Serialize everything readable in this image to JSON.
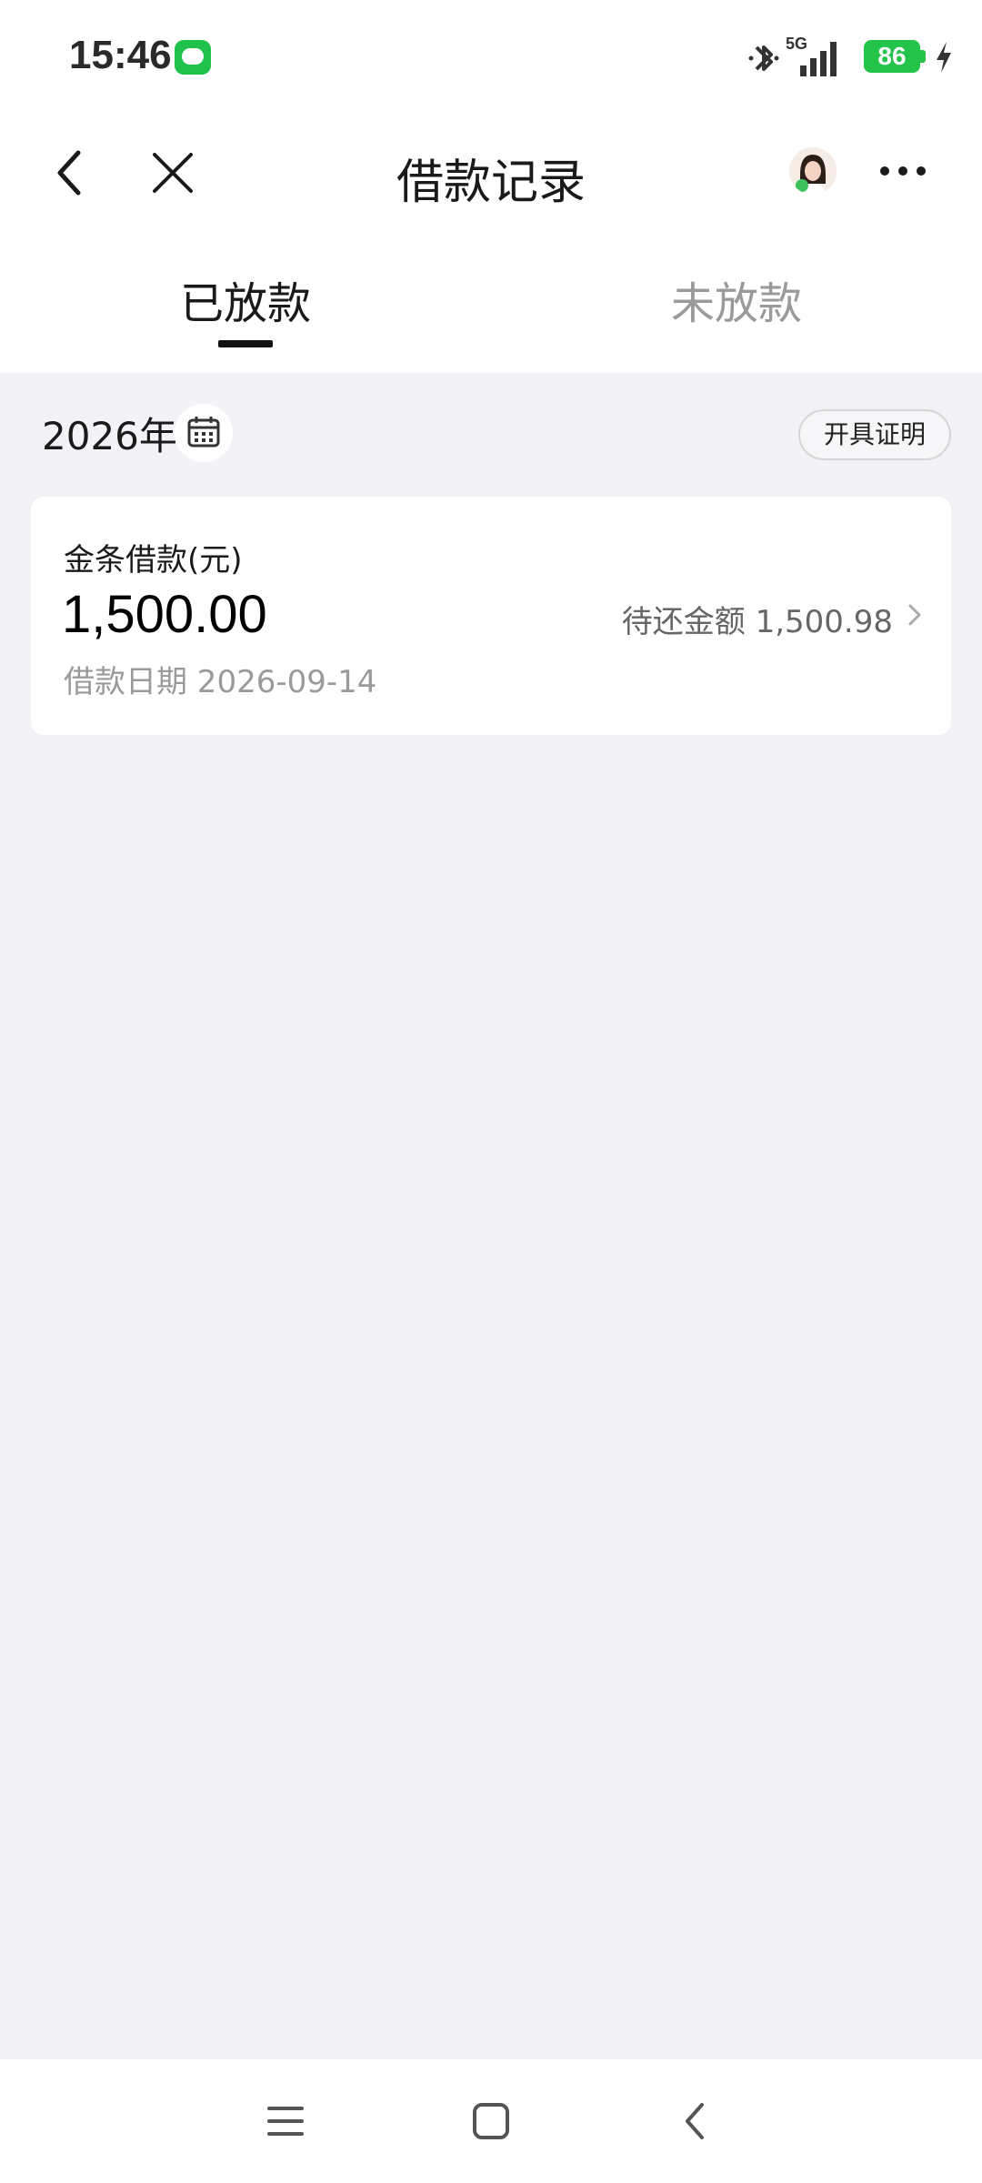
{
  "status_bar": {
    "time": "15:46",
    "network": "5G",
    "battery_level": "86",
    "icons": [
      "message-icon",
      "bluetooth-icon",
      "signal-icon",
      "battery-icon",
      "charging-icon"
    ]
  },
  "nav": {
    "title": "借款记录",
    "icons": [
      "back-icon",
      "close-icon",
      "avatar",
      "more-icon"
    ]
  },
  "tabs": [
    {
      "label": "已放款",
      "active": true
    },
    {
      "label": "未放款",
      "active": false
    }
  ],
  "filter": {
    "year": "2026年",
    "certificate_button": "开具证明"
  },
  "loans": [
    {
      "type": "金条借款(元)",
      "amount": "1,500.00",
      "date": "借款日期 2026-09-14",
      "remaining": "待还金额 1,500.98"
    }
  ],
  "colors": {
    "page_bg": "#f2f2f7",
    "accent_green": "#24c34a",
    "text_primary": "#1a1a1a",
    "text_secondary": "#9a9a9a"
  }
}
